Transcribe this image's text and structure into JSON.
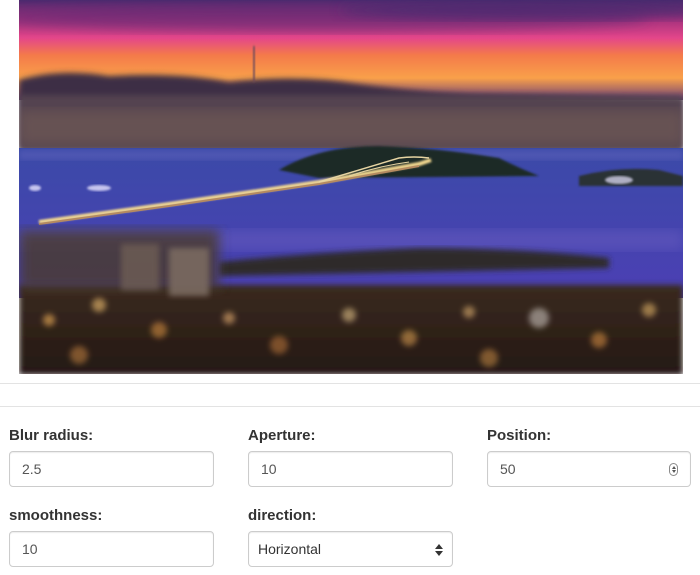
{
  "photo": {
    "subject": "tilt-shift-city-bay-bridge-night-photo"
  },
  "controls": {
    "blur_radius": {
      "label": "Blur radius:",
      "value": "2.5"
    },
    "aperture": {
      "label": "Aperture:",
      "value": "10"
    },
    "position": {
      "label": "Position:",
      "value": "50"
    },
    "smoothness": {
      "label": "smoothness:",
      "value": "10"
    },
    "direction": {
      "label": "direction:",
      "value": "Horizontal",
      "options": [
        "Horizontal"
      ]
    }
  },
  "colors": {
    "label": "#333333",
    "input_text": "#555555",
    "input_border": "#cccccc",
    "divider": "#e3e3e3"
  },
  "icons": {
    "spinner": "number-spinner-icon",
    "select": "select-arrows-icon"
  }
}
